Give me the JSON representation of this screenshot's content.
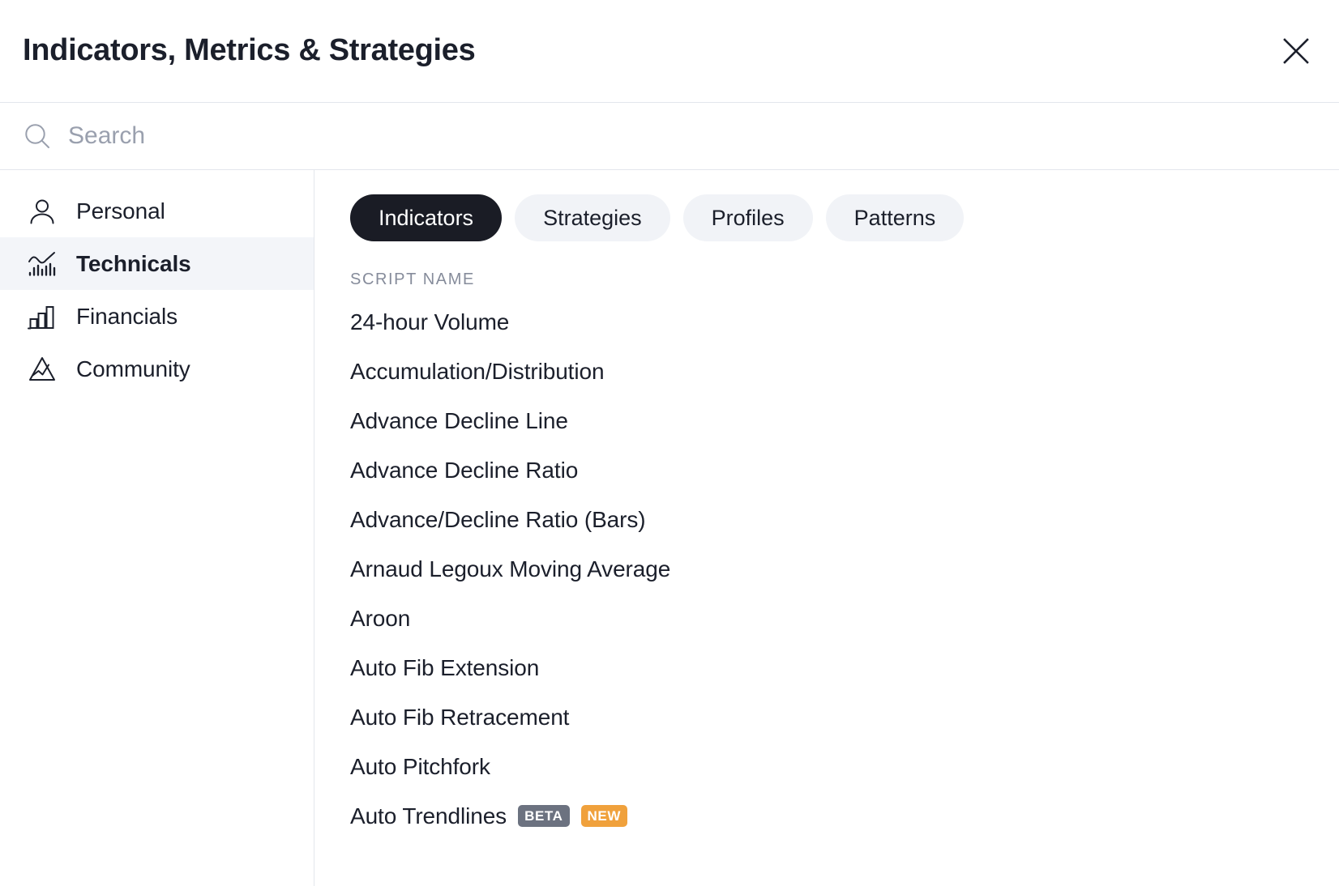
{
  "header": {
    "title": "Indicators, Metrics & Strategies",
    "close_icon": "close-icon"
  },
  "search": {
    "placeholder": "Search",
    "value": "",
    "icon": "search-icon"
  },
  "sidebar": {
    "items": [
      {
        "label": "Personal",
        "icon": "person-icon",
        "active": false
      },
      {
        "label": "Technicals",
        "icon": "line-bars-icon",
        "active": true
      },
      {
        "label": "Financials",
        "icon": "bar-chart-icon",
        "active": false
      },
      {
        "label": "Community",
        "icon": "mountain-icon",
        "active": false
      }
    ]
  },
  "main": {
    "tabs": [
      {
        "label": "Indicators",
        "active": true
      },
      {
        "label": "Strategies",
        "active": false
      },
      {
        "label": "Profiles",
        "active": false
      },
      {
        "label": "Patterns",
        "active": false
      }
    ],
    "column_header": "Script name",
    "scripts": [
      {
        "name": "24-hour Volume",
        "badges": []
      },
      {
        "name": "Accumulation/Distribution",
        "badges": []
      },
      {
        "name": "Advance Decline Line",
        "badges": []
      },
      {
        "name": "Advance Decline Ratio",
        "badges": []
      },
      {
        "name": "Advance/Decline Ratio (Bars)",
        "badges": []
      },
      {
        "name": "Arnaud Legoux Moving Average",
        "badges": []
      },
      {
        "name": "Aroon",
        "badges": []
      },
      {
        "name": "Auto Fib Extension",
        "badges": []
      },
      {
        "name": "Auto Fib Retracement",
        "badges": []
      },
      {
        "name": "Auto Pitchfork",
        "badges": []
      },
      {
        "name": "Auto Trendlines",
        "badges": [
          "BETA",
          "NEW"
        ]
      }
    ]
  },
  "colors": {
    "text": "#1b1f2b",
    "muted": "#868c9b",
    "border": "#e3e6ec",
    "pill_active_bg": "#1a1c25",
    "pill_bg": "#f1f3f7",
    "sidebar_active_bg": "#f3f5f9",
    "badge_beta": "#6c7280",
    "badge_new": "#f0a13c"
  }
}
